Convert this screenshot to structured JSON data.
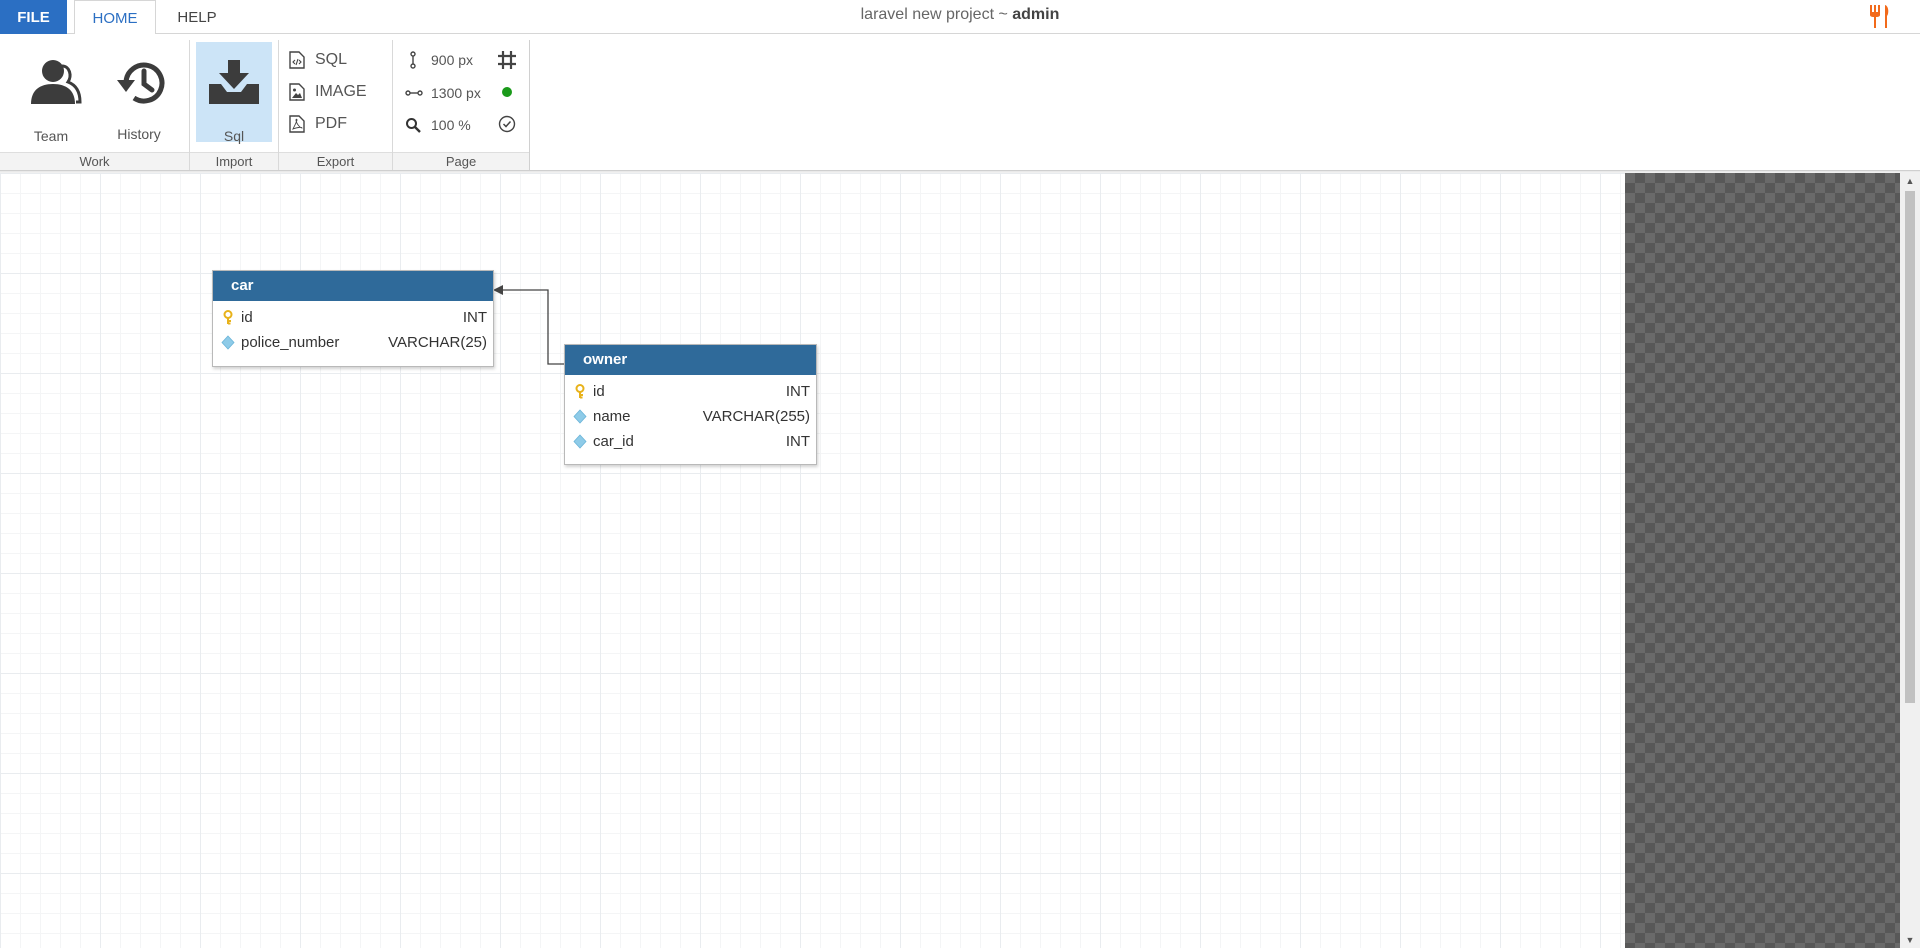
{
  "tabs": {
    "file": "FILE",
    "home": "HOME",
    "help": "HELP"
  },
  "window_title": {
    "project": "laravel new project ~ ",
    "user": "admin"
  },
  "ribbon": {
    "work": {
      "label": "Work",
      "team": "Team",
      "history": "History"
    },
    "import": {
      "label": "Import",
      "sql": "Sql"
    },
    "export": {
      "label": "Export",
      "sql": "SQL",
      "image": "IMAGE",
      "pdf": "PDF"
    },
    "page": {
      "label": "Page",
      "height": "900 px",
      "width": "1300 px",
      "zoom": "100 %"
    }
  },
  "tables": {
    "car": {
      "name": "car",
      "columns": [
        {
          "name": "id",
          "type": "INT",
          "key": "primary"
        },
        {
          "name": "police_number",
          "type": "VARCHAR(25)",
          "key": "none"
        }
      ]
    },
    "owner": {
      "name": "owner",
      "columns": [
        {
          "name": "id",
          "type": "INT",
          "key": "primary"
        },
        {
          "name": "name",
          "type": "VARCHAR(255)",
          "key": "none"
        },
        {
          "name": "car_id",
          "type": "INT",
          "key": "none"
        }
      ]
    }
  },
  "colors": {
    "accent": "#2b6fc3",
    "table_header": "#2f6a9a",
    "primary_key": "#e8b21a",
    "column_diamond": "#8ecbe8",
    "active_button": "#cce4f7",
    "status_dot": "#1a9a1a",
    "brand": "#f26a1b"
  },
  "icons": {
    "team": "team-icon",
    "history": "history-icon",
    "import_sql": "import-tray-icon",
    "export_sql": "sql-file-icon",
    "export_image": "image-file-icon",
    "export_pdf": "pdf-file-icon",
    "page_height": "height-icon",
    "page_width": "width-icon",
    "zoom": "zoom-icon",
    "grid": "grid-icon",
    "status": "status-dot-icon",
    "validate": "check-circle-icon",
    "brand": "fork-knife-icon"
  }
}
